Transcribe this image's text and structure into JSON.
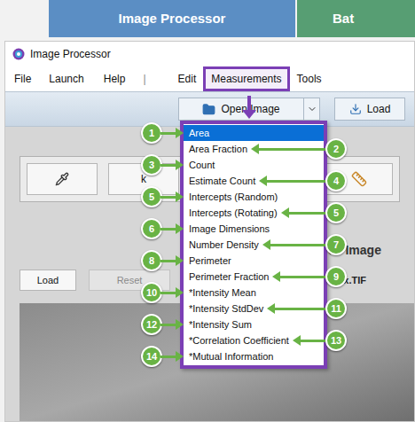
{
  "app_tabs": [
    {
      "label": "Image Processor",
      "selected": true,
      "color": "#5b8ec4"
    },
    {
      "label": "Bat",
      "selected": false,
      "color": "#4f9a6d"
    }
  ],
  "window": {
    "title": "Image Processor"
  },
  "menubar": [
    {
      "kind": "menu",
      "label": "File",
      "selected": false
    },
    {
      "kind": "menu",
      "label": "Launch",
      "selected": false
    },
    {
      "kind": "menu",
      "label": "Help",
      "selected": false
    },
    {
      "kind": "separator",
      "label": "|",
      "selected": false
    },
    {
      "kind": "menu",
      "label": "Edit",
      "selected": false
    },
    {
      "kind": "menu",
      "label": "Measurements",
      "selected": true
    },
    {
      "kind": "menu",
      "label": "Tools",
      "selected": false
    }
  ],
  "toolbar": {
    "open_button": "Open Image",
    "load_button": "Load"
  },
  "tool_panel": {
    "text_button": "k"
  },
  "reference_panel": {
    "title": "ce Image",
    "load_button": "Load",
    "reset_button": {
      "label": "Reset",
      "disabled": true
    },
    "file_name": "kx.TIF"
  },
  "measurements_menu": {
    "items": [
      {
        "label": "Area",
        "selected": true,
        "callout": {
          "number": "1",
          "side": "left"
        }
      },
      {
        "label": "Area Fraction",
        "selected": false,
        "callout": {
          "number": "2",
          "side": "right"
        }
      },
      {
        "label": "Count",
        "selected": false,
        "callout": {
          "number": "3",
          "side": "left"
        }
      },
      {
        "label": "Estimate Count",
        "selected": false,
        "callout": {
          "number": "4",
          "side": "right"
        }
      },
      {
        "label": "Intercepts (Random)",
        "selected": false,
        "callout": {
          "number": "5",
          "side": "left"
        }
      },
      {
        "label": "Intercepts (Rotating)",
        "selected": false,
        "callout": {
          "number": "5",
          "side": "right"
        }
      },
      {
        "label": "Image Dimensions",
        "selected": false,
        "callout": {
          "number": "6",
          "side": "left"
        }
      },
      {
        "label": "Number Density",
        "selected": false,
        "callout": {
          "number": "7",
          "side": "right"
        }
      },
      {
        "label": "Perimeter",
        "selected": false,
        "callout": {
          "number": "8",
          "side": "left"
        }
      },
      {
        "label": "Perimeter Fraction",
        "selected": false,
        "callout": {
          "number": "9",
          "side": "right"
        }
      },
      {
        "label": "*Intensity Mean",
        "selected": false,
        "callout": {
          "number": "10",
          "side": "left"
        }
      },
      {
        "label": "*Intensity StdDev",
        "selected": false,
        "callout": {
          "number": "11",
          "side": "right"
        }
      },
      {
        "label": "*Intensity Sum",
        "selected": false,
        "callout": {
          "number": "12",
          "side": "left"
        }
      },
      {
        "label": "*Correlation Coefficient",
        "selected": false,
        "callout": {
          "number": "13",
          "side": "right"
        }
      },
      {
        "label": "*Mutual Information",
        "selected": false,
        "callout": {
          "number": "14",
          "side": "left"
        }
      }
    ]
  }
}
